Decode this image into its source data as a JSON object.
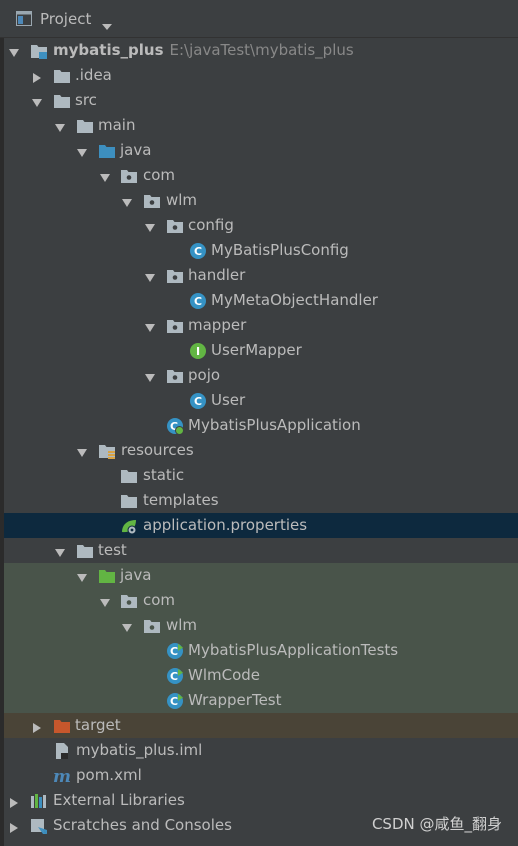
{
  "header": {
    "title": "Project",
    "title_icon": "project-window-icon",
    "dropdown_icon": "chevron-down-icon"
  },
  "tree": {
    "root": {
      "name": "mybatis_plus",
      "path": "E:\\javaTest\\mybatis_plus"
    },
    "idea": ".idea",
    "src": "src",
    "main": "main",
    "main_java": "java",
    "main_com": "com",
    "main_wlm": "wlm",
    "config": "config",
    "mybatis_plus_config": "MyBatisPlusConfig",
    "handler": "handler",
    "meta_handler": "MyMetaObjectHandler",
    "mapper": "mapper",
    "user_mapper": "UserMapper",
    "pojo": "pojo",
    "user": "User",
    "app": "MybatisPlusApplication",
    "resources": "resources",
    "static": "static",
    "templates": "templates",
    "app_props": "application.properties",
    "test": "test",
    "test_java": "java",
    "test_com": "com",
    "test_wlm": "wlm",
    "app_tests": "MybatisPlusApplicationTests",
    "wlm_code": "WlmCode",
    "wrapper_test": "WrapperTest",
    "target": "target",
    "iml": "mybatis_plus.iml",
    "pom": "pom.xml",
    "external_libs": "External Libraries",
    "scratches": "Scratches and Consoles"
  },
  "colors": {
    "selected_row": "#0d293e",
    "test_row": "#49544a",
    "excluded_row": "#4a4437",
    "class_icon": "#3592c4",
    "interface_icon": "#62b543",
    "folder": "#aeb9c0",
    "source_folder": "#3d8fbf",
    "test_folder": "#62b543",
    "excluded_folder": "#c7572c"
  },
  "watermark": "CSDN @咸鱼_翻身"
}
